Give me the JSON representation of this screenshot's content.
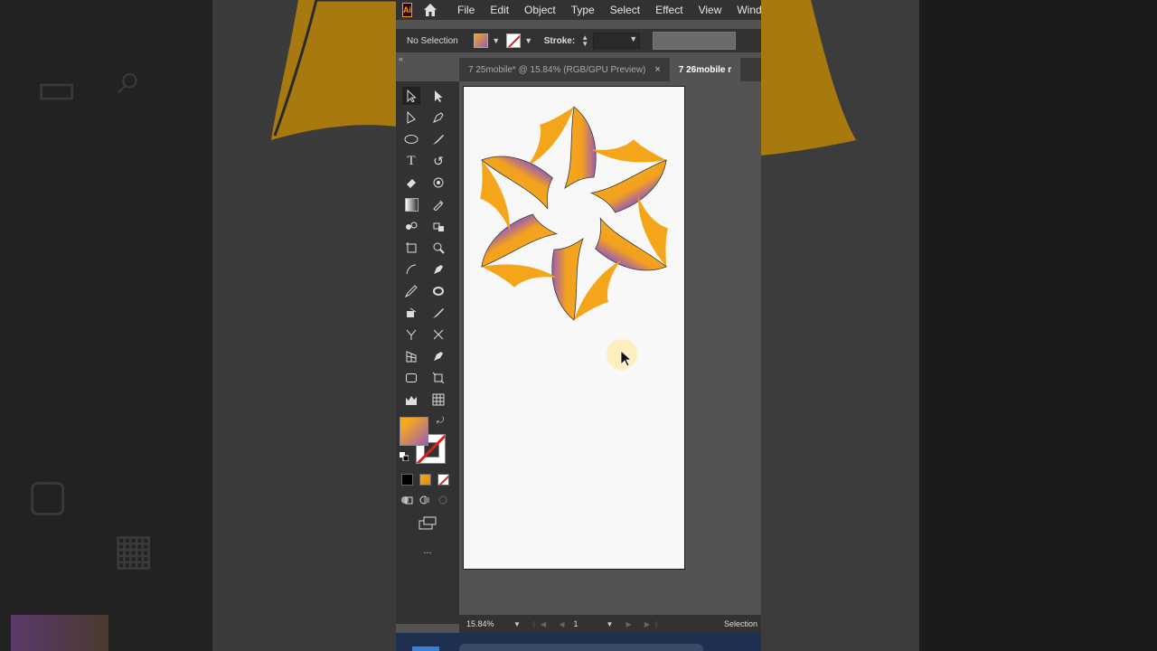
{
  "menu": {
    "app_logo": "Ai",
    "items": [
      "File",
      "Edit",
      "Object",
      "Type",
      "Select",
      "Effect",
      "View",
      "Windo"
    ]
  },
  "control": {
    "selection_label": "No Selection",
    "stroke_label": "Stroke:"
  },
  "tabs": [
    {
      "label": "7 25mobile* @ 15.84% (RGB/GPU Preview)",
      "close": "×"
    },
    {
      "label": "7 26mobile r"
    }
  ],
  "status": {
    "zoom": "15.84%",
    "page": "1",
    "tool_status": "Selection"
  },
  "toolbar": {
    "more": "..."
  },
  "colors": {
    "gradient_start": "#f7a81b",
    "gradient_end": "#9b5db5",
    "accent_orange": "#ff9a00",
    "none_red": "#e02020"
  }
}
